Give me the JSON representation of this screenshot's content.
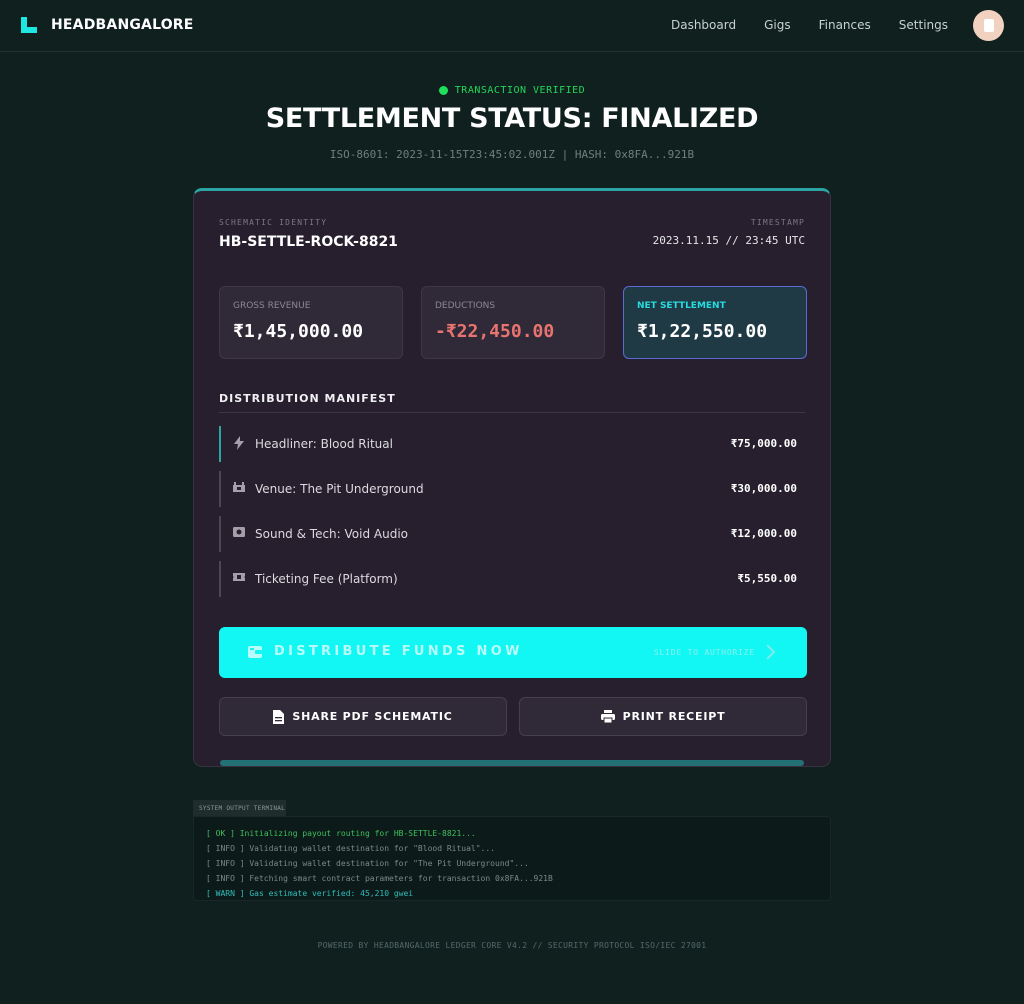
{
  "nav": {
    "brand": "HEADBANGALORE",
    "links": [
      "Dashboard",
      "Gigs",
      "Finances",
      "Settings"
    ]
  },
  "header": {
    "status": "TRANSACTION VERIFIED",
    "title": "SETTLEMENT STATUS: FINALIZED",
    "subline": "ISO-8601: 2023-11-15T23:45:02.001Z | HASH: 0x8FA...921B"
  },
  "card": {
    "identity_label": "SCHEMATIC IDENTITY",
    "identity_value": "HB-SETTLE-ROCK-8821",
    "timestamp_label": "TIMESTAMP",
    "timestamp_value": "2023.11.15 // 23:45 UTC",
    "stats": [
      {
        "label": "GROSS REVENUE",
        "value": "₹1,45,000.00",
        "color": "#ffffff"
      },
      {
        "label": "DEDUCTIONS",
        "value": "-₹22,450.00",
        "color": "#e8746f"
      },
      {
        "label": "NET SETTLEMENT",
        "value": "₹1,22,550.00",
        "color": "#ffffff"
      }
    ],
    "manifest_title": "DISTRIBUTION MANIFEST",
    "manifest": [
      {
        "icon": "bolt-icon",
        "label": "Headliner: Blood Ritual",
        "amount": "₹75,000.00"
      },
      {
        "icon": "stage-icon",
        "label": "Venue: The Pit Underground",
        "amount": "₹30,000.00"
      },
      {
        "icon": "speaker-icon",
        "label": "Sound & Tech: Void Audio",
        "amount": "₹12,000.00"
      },
      {
        "icon": "ticket-icon",
        "label": "Ticketing Fee (Platform)",
        "amount": "₹5,550.00"
      }
    ],
    "cta_label": "DISTRIBUTE FUNDS NOW",
    "cta_hint": "SLIDE TO AUTHORIZE",
    "share_label": "SHARE PDF SCHEMATIC",
    "print_label": "PRINT RECEIPT"
  },
  "terminal": {
    "tab": "SYSTEM OUTPUT TERMINAL",
    "lines": [
      {
        "tag": "[ OK ]",
        "text": "Initializing payout routing for HB-SETTLE-8821..."
      },
      {
        "tag": "[ INFO ]",
        "text": "Validating wallet destination for \"Blood Ritual\"..."
      },
      {
        "tag": "[ INFO ]",
        "text": "Validating wallet destination for \"The Pit Underground\"..."
      },
      {
        "tag": "[ INFO ]",
        "text": "Fetching smart contract parameters for transaction 0x8FA...921B"
      },
      {
        "tag": "[ WARN ]",
        "text": "Gas estimate verified: 45,210 gwei"
      }
    ]
  },
  "footer": "POWERED BY HEADBANGALORE LEDGER CORE V4.2 // SECURITY PROTOCOL ISO/IEC 27001",
  "colors": {
    "accent": "#12f7f3",
    "ok": "#22d65a",
    "deduction": "#e8746f",
    "background": "#0f201f",
    "card": "#271f2d"
  }
}
